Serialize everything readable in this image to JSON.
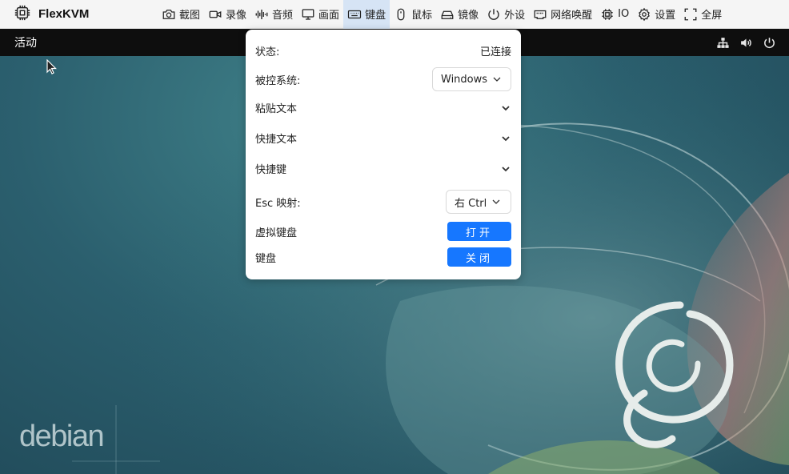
{
  "brand": {
    "name": "FlexKVM",
    "icon": "kvm-chip-icon"
  },
  "toolbar": {
    "items": [
      {
        "label": "截图",
        "icon": "camera-icon"
      },
      {
        "label": "录像",
        "icon": "video-icon"
      },
      {
        "label": "音频",
        "icon": "audio-wave-icon"
      },
      {
        "label": "画面",
        "icon": "monitor-icon"
      },
      {
        "label": "键盘",
        "icon": "keyboard-icon",
        "active": true
      },
      {
        "label": "鼠标",
        "icon": "mouse-icon"
      },
      {
        "label": "镜像",
        "icon": "disk-icon"
      },
      {
        "label": "外设",
        "icon": "power-icon"
      },
      {
        "label": "网络唤醒",
        "icon": "network-port-icon"
      },
      {
        "label": "IO",
        "icon": "chip-icon"
      },
      {
        "label": "设置",
        "icon": "gear-icon"
      },
      {
        "label": "全屏",
        "icon": "fullscreen-icon"
      }
    ]
  },
  "desktop": {
    "activities": "活动",
    "logo_text": "debian",
    "tray": [
      "network-icon",
      "volume-icon",
      "power-icon"
    ]
  },
  "keyboard_panel": {
    "status_label": "状态:",
    "status_value": "已连接",
    "os_label": "被控系统:",
    "os_value": "Windows",
    "paste_label": "粘贴文本",
    "shortcut_text_label": "快捷文本",
    "hotkey_label": "快捷键",
    "esc_label": "Esc 映射:",
    "esc_value": "右 Ctrl",
    "virtual_kb_label": "虚拟键盘",
    "virtual_kb_button": "打开",
    "keyboard_label": "键盘",
    "keyboard_button": "关闭"
  },
  "colors": {
    "accent": "#1677ff",
    "active_tab": "#d6e4f5",
    "topbar": "#0e0e0e"
  }
}
